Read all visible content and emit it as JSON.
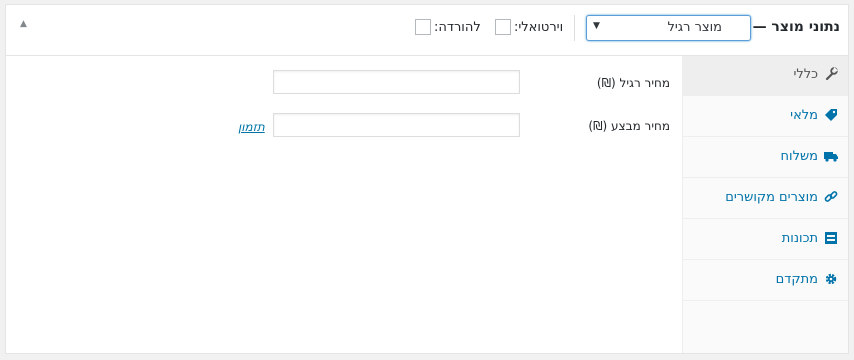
{
  "header": {
    "title": "נתוני מוצר —",
    "product_type": "מוצר רגיל",
    "virtual_label": "וירטואלי:",
    "download_label": "להורדה:"
  },
  "sidebar": {
    "items": [
      {
        "label": "כללי",
        "icon": "wrench-icon",
        "active": true
      },
      {
        "label": "מלאי",
        "icon": "tag-icon",
        "active": false
      },
      {
        "label": "משלוח",
        "icon": "truck-icon",
        "active": false
      },
      {
        "label": "מוצרים מקושרים",
        "icon": "link-icon",
        "active": false
      },
      {
        "label": "תכונות",
        "icon": "table-icon",
        "active": false
      },
      {
        "label": "מתקדם",
        "icon": "gear-icon",
        "active": false
      }
    ]
  },
  "general": {
    "regular_price_label": "מחיר רגיל (₪)",
    "regular_price_value": "",
    "sale_price_label": "מחיר מבצע (₪)",
    "sale_price_value": "",
    "schedule_link": "תזמון"
  },
  "colors": {
    "accent": "#0073aa",
    "active_tab_bg": "#eeeeee",
    "focus_border": "#5b9dd9"
  }
}
